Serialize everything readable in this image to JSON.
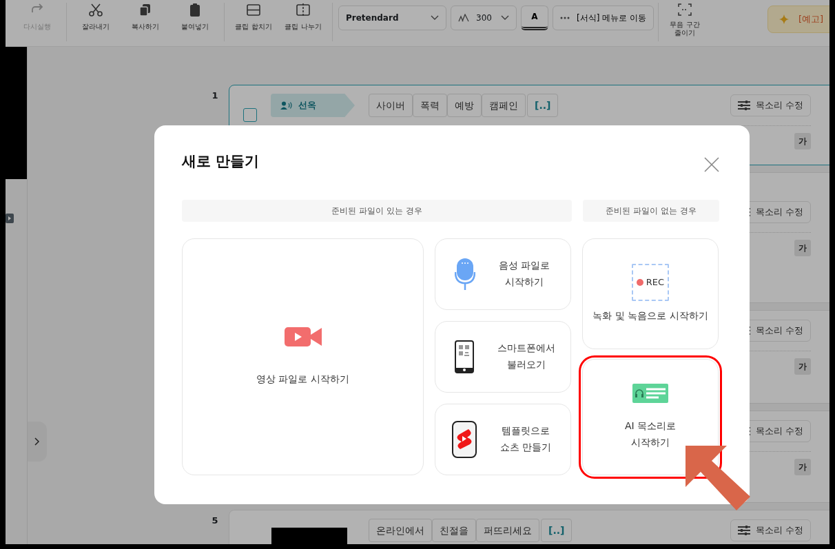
{
  "toolbar": {
    "actions": [
      {
        "label": "다시실행",
        "kind": "redo",
        "disabled": true
      },
      {
        "label": "잘라내기",
        "kind": "scissors",
        "disabled": false
      },
      {
        "label": "복사하기",
        "kind": "copy",
        "disabled": false
      },
      {
        "label": "붙여넣기",
        "kind": "paste",
        "disabled": false
      },
      {
        "label": "클립 합치기",
        "kind": "merge",
        "disabled": false
      },
      {
        "label": "클립 나누기",
        "kind": "split",
        "disabled": false
      }
    ],
    "font_family": "Pretendard",
    "font_size": "300",
    "text_color_button": "A",
    "format_menu": "[서식] 메뉴로 이동",
    "silence_button": "무음 구간\n줄이기",
    "preview_button": "[예고]"
  },
  "script_rows": [
    {
      "number": "1",
      "selected": true,
      "speaker": "선옥",
      "words": [
        {
          "text": "사이버",
          "kind": "word"
        },
        {
          "text": "폭력",
          "kind": "word"
        },
        {
          "text": "예방",
          "kind": "word"
        },
        {
          "text": "캠페인",
          "kind": "word"
        },
        {
          "text": "[..]",
          "kind": "gap"
        }
      ],
      "voice_button": "목소리 수정",
      "font_badge": "가"
    },
    {
      "selected": false,
      "voice_button": "목소리 수정",
      "font_badge": "가"
    },
    {
      "selected": false,
      "voice_button": "목소리 수정",
      "font_badge": "가"
    },
    {
      "selected": false,
      "voice_button": "목소리 수정",
      "font_badge": "가"
    },
    {
      "number": "5",
      "selected": false,
      "words": [
        {
          "text": "온라인에서",
          "kind": "word"
        },
        {
          "text": "친절을",
          "kind": "word"
        },
        {
          "text": "퍼뜨리세요",
          "kind": "word"
        },
        {
          "text": "[..]",
          "kind": "gap"
        }
      ],
      "voice_button": "목소리 수정"
    }
  ],
  "dialog": {
    "title": "새로 만들기",
    "with_file_label": "준비된 파일이 있는 경우",
    "without_file_label": "준비된 파일이 없는 경우",
    "with_file_options": [
      {
        "label": "영상 파일로 시작하기",
        "kind": "video",
        "highlighted": false
      },
      {
        "label": "음성 파일로\n시작하기",
        "kind": "audio",
        "highlighted": false
      },
      {
        "label": "스마트폰에서\n불러오기",
        "kind": "phone",
        "highlighted": false
      },
      {
        "label": "템플릿으로\n쇼츠 만들기",
        "kind": "template",
        "highlighted": false
      }
    ],
    "without_file_options": [
      {
        "label": "녹화 및 녹음으로 시작하기",
        "kind": "record",
        "badge": "REC",
        "highlighted": false
      },
      {
        "label": "AI 목소리로\n시작하기",
        "kind": "ai_voice",
        "highlighted": true
      }
    ]
  }
}
